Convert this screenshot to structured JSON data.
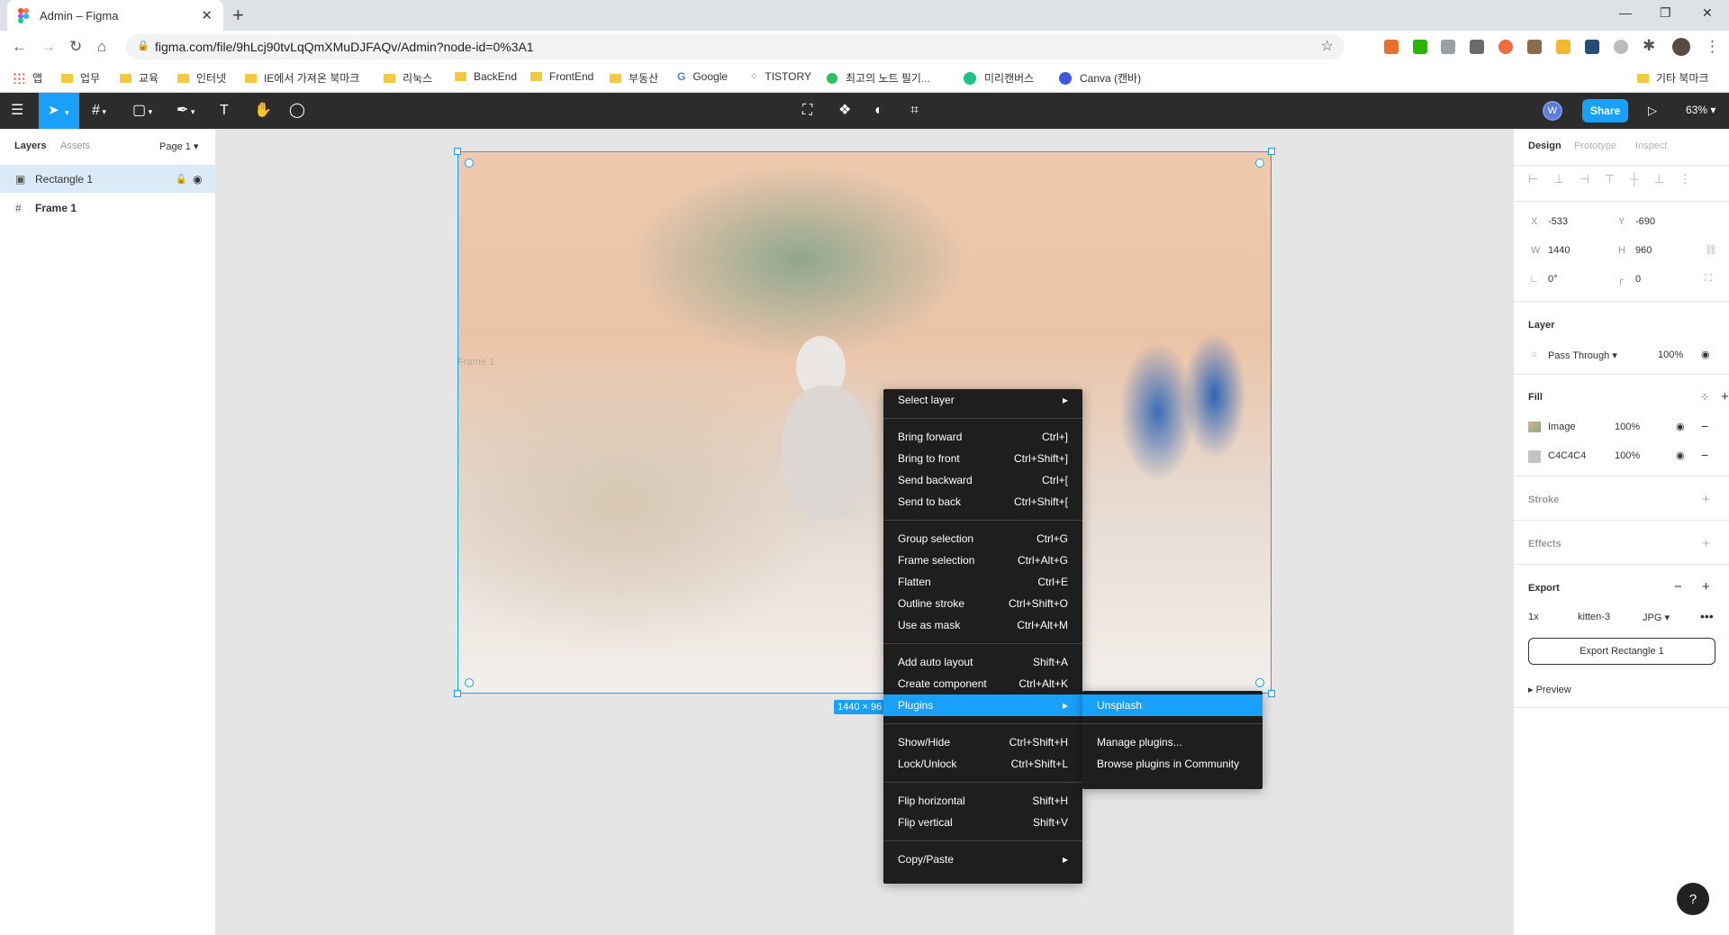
{
  "browser": {
    "tab_title": "Admin – Figma",
    "url": "figma.com/file/9hLcj90tvLqQmXMuDJFAQv/Admin?node-id=0%3A1",
    "bookmarks": [
      "앱",
      "업무",
      "교육",
      "인터넷",
      "IE에서 가져온 북마크",
      "리눅스",
      "BackEnd",
      "FrontEnd",
      "부동산",
      "Google",
      "TISTORY",
      "최고의 노트 필기...",
      "미리캔버스",
      "Canva (캔바)",
      "기타 북마크"
    ]
  },
  "toolbar": {
    "share_label": "Share",
    "avatar_initial": "W",
    "zoom": "63%"
  },
  "left_panel": {
    "tabs": {
      "layers": "Layers",
      "assets": "Assets",
      "page": "Page 1"
    },
    "layers": [
      {
        "name": "Rectangle 1",
        "icon": "image-icon",
        "selected": true
      },
      {
        "name": "Frame 1",
        "icon": "frame-icon",
        "selected": false
      }
    ]
  },
  "canvas": {
    "frame_label": "Frame 1",
    "size_badge": "1440 × 96"
  },
  "context_menu": {
    "select_layer": "Select layer",
    "groups": [
      [
        {
          "label": "Bring forward",
          "shortcut": "Ctrl+]"
        },
        {
          "label": "Bring to front",
          "shortcut": "Ctrl+Shift+]"
        },
        {
          "label": "Send backward",
          "shortcut": "Ctrl+["
        },
        {
          "label": "Send to back",
          "shortcut": "Ctrl+Shift+["
        }
      ],
      [
        {
          "label": "Group selection",
          "shortcut": "Ctrl+G"
        },
        {
          "label": "Frame selection",
          "shortcut": "Ctrl+Alt+G"
        },
        {
          "label": "Flatten",
          "shortcut": "Ctrl+E"
        },
        {
          "label": "Outline stroke",
          "shortcut": "Ctrl+Shift+O"
        },
        {
          "label": "Use as mask",
          "shortcut": "Ctrl+Alt+M"
        }
      ],
      [
        {
          "label": "Add auto layout",
          "shortcut": "Shift+A"
        },
        {
          "label": "Create component",
          "shortcut": "Ctrl+Alt+K"
        },
        {
          "label": "Plugins",
          "shortcut": ""
        }
      ],
      [
        {
          "label": "Show/Hide",
          "shortcut": "Ctrl+Shift+H"
        },
        {
          "label": "Lock/Unlock",
          "shortcut": "Ctrl+Shift+L"
        }
      ],
      [
        {
          "label": "Flip horizontal",
          "shortcut": "Shift+H"
        },
        {
          "label": "Flip vertical",
          "shortcut": "Shift+V"
        }
      ]
    ],
    "copy_paste": "Copy/Paste",
    "submenu": {
      "unsplash": "Unsplash",
      "manage": "Manage plugins...",
      "browse": "Browse plugins in Community"
    }
  },
  "right_panel": {
    "tabs": {
      "design": "Design",
      "prototype": "Prototype",
      "inspect": "Inspect"
    },
    "x_label": "X",
    "x": "-533",
    "y_label": "Y",
    "y": "-690",
    "w_label": "W",
    "w": "1440",
    "h_label": "H",
    "h": "960",
    "rotation": "0°",
    "radius": "0",
    "layer": {
      "title": "Layer",
      "blend": "Pass Through",
      "opacity": "100%"
    },
    "fill": {
      "title": "Fill",
      "items": [
        {
          "name": "Image",
          "opacity": "100%"
        },
        {
          "name": "C4C4C4",
          "opacity": "100%"
        }
      ]
    },
    "stroke": "Stroke",
    "effects": "Effects",
    "export": {
      "title": "Export",
      "scale": "1x",
      "suffix": "kitten-3",
      "format": "JPG",
      "button": "Export Rectangle 1",
      "preview": "Preview"
    }
  },
  "help": "?"
}
